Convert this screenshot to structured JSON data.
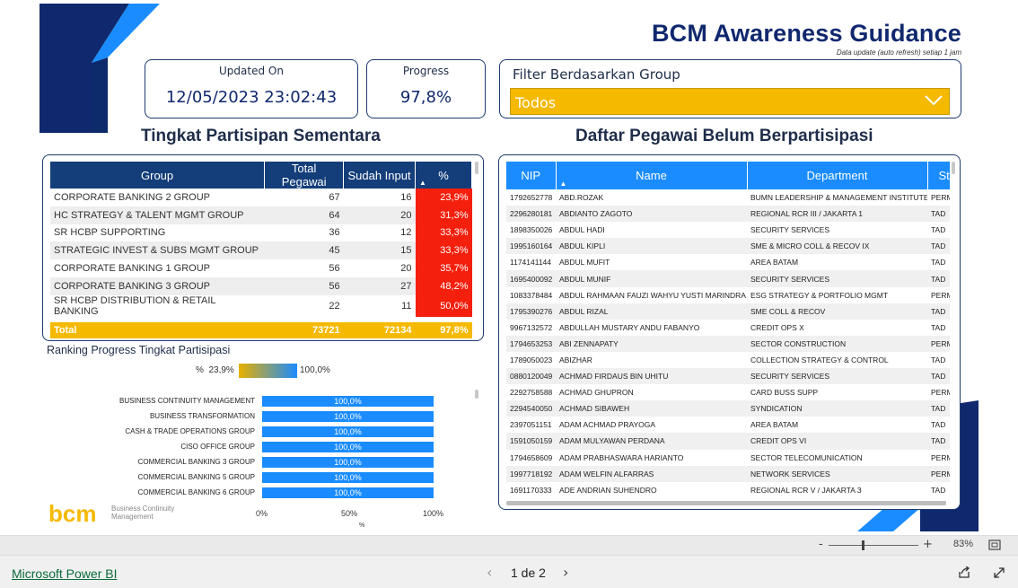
{
  "header": {
    "title": "BCM Awareness Guidance",
    "subtitle": "Data update (auto refresh) setiap 1 jam"
  },
  "kpi": {
    "updated_label": "Updated On",
    "updated_value": "12/05/2023 23:02:43",
    "progress_label": "Progress",
    "progress_value": "97,8%"
  },
  "filter": {
    "label": "Filter Berdasarkan Group",
    "selected": "Todos"
  },
  "participation": {
    "title": "Tingkat Partisipan Sementara",
    "columns": [
      "Group",
      "Total Pegawai",
      "Sudah Input",
      "%"
    ],
    "rows": [
      [
        "CORPORATE BANKING 2 GROUP",
        "67",
        "16",
        "23,9%"
      ],
      [
        "HC STRATEGY & TALENT MGMT GROUP",
        "64",
        "20",
        "31,3%"
      ],
      [
        "SR HCBP SUPPORTING",
        "36",
        "12",
        "33,3%"
      ],
      [
        "STRATEGIC INVEST & SUBS MGMT GROUP",
        "45",
        "15",
        "33,3%"
      ],
      [
        "CORPORATE BANKING 1 GROUP",
        "56",
        "20",
        "35,7%"
      ],
      [
        "CORPORATE BANKING 3 GROUP",
        "56",
        "27",
        "48,2%"
      ],
      [
        "SR HCBP DISTRIBUTION & RETAIL BANKING",
        "22",
        "11",
        "50,0%"
      ]
    ],
    "total": [
      "Total",
      "73721",
      "72134",
      "97,8%"
    ]
  },
  "employees": {
    "title": "Daftar Pegawai Belum Berpartisipasi",
    "columns": [
      "NIP",
      "Name",
      "Department",
      "St"
    ],
    "rows": [
      [
        "1792652778",
        "ABD.ROZAK",
        "BUMN LEADERSHIP & MANAGEMENT INSTITUTE",
        "PERM"
      ],
      [
        "2296280181",
        "ABDIANTO ZAGOTO",
        "REGIONAL RCR III / JAKARTA 1",
        "TAD"
      ],
      [
        "1898350026",
        "ABDUL HADI",
        "SECURITY SERVICES",
        "TAD"
      ],
      [
        "1995160164",
        "ABDUL KIPLI",
        "SME & MICRO COLL & RECOV IX",
        "TAD"
      ],
      [
        "1174141144",
        "ABDUL MUFIT",
        "AREA BATAM",
        "TAD"
      ],
      [
        "1695400092",
        "ABDUL MUNIF",
        "SECURITY SERVICES",
        "TAD"
      ],
      [
        "1083378484",
        "ABDUL RAHMAAN FAUZI WAHYU YUSTI MARINDRA",
        "ESG STRATEGY & PORTFOLIO MGMT",
        "PERM"
      ],
      [
        "1795390276",
        "ABDUL RIZAL",
        "SME COLL & RECOV",
        "TAD"
      ],
      [
        "9967132572",
        "ABDULLAH MUSTARY ANDU FABANYO",
        "CREDIT OPS X",
        "TAD"
      ],
      [
        "1794653253",
        "ABI ZENNAPATY",
        "SECTOR CONSTRUCTION",
        "PERM"
      ],
      [
        "1789050023",
        "ABIZHAR",
        "COLLECTION STRATEGY & CONTROL",
        "TAD"
      ],
      [
        "0880120049",
        "ACHMAD FIRDAUS BIN UHITU",
        "SECURITY SERVICES",
        "TAD"
      ],
      [
        "2292758588",
        "ACHMAD GHUPRON",
        "CARD BUSS SUPP",
        "PERM"
      ],
      [
        "2294540050",
        "ACHMAD SIBAWEH",
        "SYNDICATION",
        "TAD"
      ],
      [
        "2397051151",
        "ADAM ACHMAD PRAYOGA",
        "AREA BATAM",
        "TAD"
      ],
      [
        "1591050159",
        "ADAM MULYAWAN PERDANA",
        "CREDIT OPS VI",
        "TAD"
      ],
      [
        "1794658609",
        "ADAM PRABHASWARA HARIANTO",
        "SECTOR TELECOMUNICATION",
        "PERM"
      ],
      [
        "1997718192",
        "ADAM WELFIN ALFARRAS",
        "NETWORK SERVICES",
        "PERM"
      ],
      [
        "1691170333",
        "ADE ANDRIAN SUHENDRO",
        "REGIONAL RCR V / JAKARTA 3",
        "TAD"
      ]
    ]
  },
  "ranking": {
    "title": "Ranking Progress Tingkat Partisipasi",
    "legend_label": "%",
    "legend_min": "23,9%",
    "legend_max": "100,0%",
    "axis_ticks": [
      "0%",
      "50%",
      "100%"
    ],
    "axis_label": "%",
    "colors": {
      "low": "#e8b000",
      "high": "#1a8cff"
    }
  },
  "chart_data": {
    "type": "bar",
    "title": "Ranking Progress Tingkat Partisipasi",
    "categories": [
      "BUSINESS CONTINUITY MANAGEMENT",
      "BUSINESS TRANSFORMATION",
      "CASH & TRADE OPERATIONS GROUP",
      "CISO OFFICE GROUP",
      "COMMERCIAL BANKING 3 GROUP",
      "COMMERCIAL BANKING 5 GROUP",
      "COMMERCIAL BANKING 6 GROUP"
    ],
    "values": [
      100,
      100,
      100,
      100,
      100,
      100,
      100
    ],
    "value_labels": [
      "100,0%",
      "100,0%",
      "100,0%",
      "100,0%",
      "100,0%",
      "100,0%",
      "100,0%"
    ],
    "xlabel": "%",
    "xlim": [
      0,
      100
    ],
    "x_ticks": [
      "0%",
      "50%",
      "100%"
    ]
  },
  "logo": {
    "text": "bcm",
    "caption_line1": "Business Continuity",
    "caption_line2": "Management"
  },
  "statusbar": {
    "zoom_minus": "-",
    "zoom_plus": "+",
    "zoom_value": "83%"
  },
  "footer": {
    "brand": "Microsoft Power BI",
    "page": "1 de 2",
    "prev": "‹",
    "next": "›"
  }
}
